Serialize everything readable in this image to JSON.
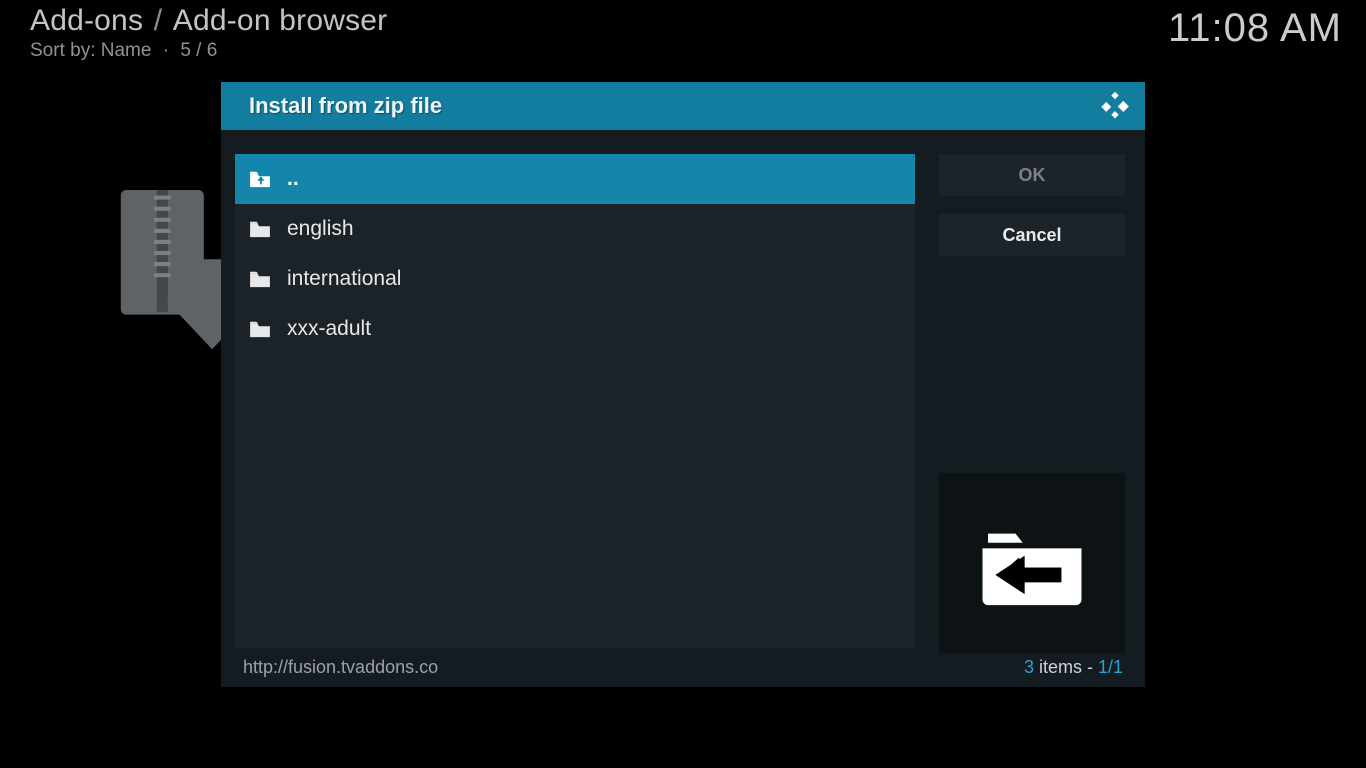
{
  "header": {
    "breadcrumb_a": "Add-ons",
    "breadcrumb_b": "Add-on browser",
    "sort_label": "Sort by: Name",
    "position": "5 / 6",
    "clock": "11:08 AM"
  },
  "dialog": {
    "title": "Install from zip file",
    "buttons": {
      "ok": "OK",
      "cancel": "Cancel"
    },
    "items": [
      {
        "label": "..",
        "selected": true,
        "up": true
      },
      {
        "label": "english",
        "selected": false,
        "up": false
      },
      {
        "label": "international",
        "selected": false,
        "up": false
      },
      {
        "label": "xxx-adult",
        "selected": false,
        "up": false
      }
    ],
    "footer": {
      "path": "http://fusion.tvaddons.co",
      "count_num": "3",
      "count_word": " items - ",
      "page": "1/1"
    }
  }
}
